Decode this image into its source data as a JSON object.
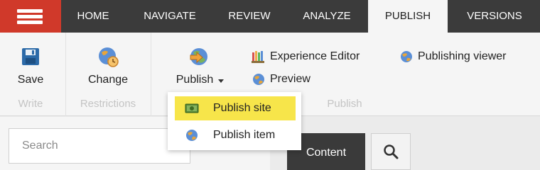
{
  "topbar": {
    "tabs": [
      {
        "label": "HOME"
      },
      {
        "label": "NAVIGATE"
      },
      {
        "label": "REVIEW"
      },
      {
        "label": "ANALYZE"
      },
      {
        "label": "PUBLISH",
        "active": true
      },
      {
        "label": "VERSIONS"
      }
    ]
  },
  "ribbon": {
    "write": {
      "save_label": "Save",
      "group_label": "Write"
    },
    "restrictions": {
      "change_label": "Change",
      "group_label": "Restrictions"
    },
    "publish": {
      "publish_label": "Publish",
      "experience_editor_label": "Experience Editor",
      "preview_label": "Preview",
      "publishing_viewer_label": "Publishing viewer",
      "group_label": "Publish"
    }
  },
  "publish_menu": {
    "items": [
      {
        "label": "Publish site",
        "highlighted": true
      },
      {
        "label": "Publish item"
      }
    ]
  },
  "search": {
    "placeholder": "Search"
  },
  "content_button": {
    "label": "Content"
  },
  "colors": {
    "hamburger_bg": "#d0392a",
    "topbar_bg": "#3b3b3b",
    "highlight": "#f7e54a",
    "content_button_bg": "#3a3a3a",
    "save_icon": "#2c6aa8"
  },
  "icons": {
    "menu": "hamburger-menu-icon",
    "save": "floppy-disk-icon",
    "change": "globe-clock-icon",
    "publish": "globe-arrow-icon",
    "experience_editor": "pencils-icon",
    "preview": "globe-icon",
    "publishing_viewer": "globe-icon",
    "publish_site": "money-icon",
    "publish_item": "globe-icon",
    "search": "magnifier-icon"
  }
}
